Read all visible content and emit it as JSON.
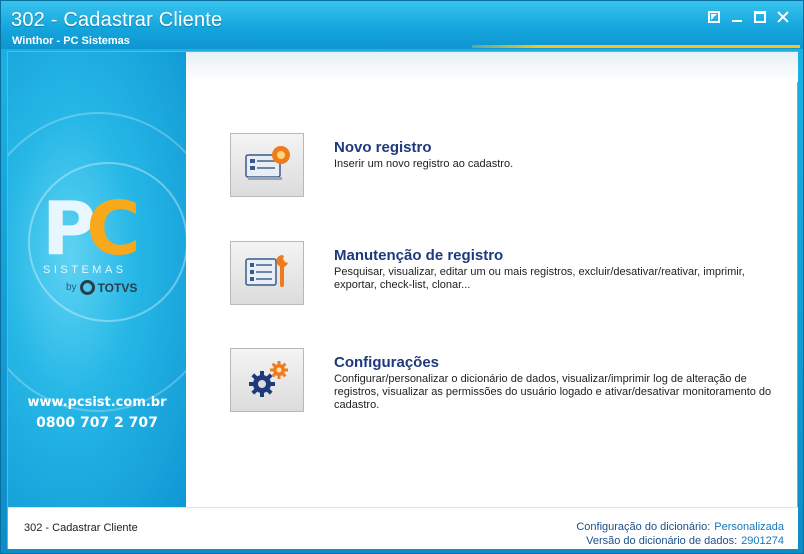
{
  "window": {
    "title": "302 - Cadastrar Cliente",
    "subtitle": "Winthor - PC Sistemas",
    "accent_color": "#f7c31b",
    "title_bar_color": "#14a6dd"
  },
  "sidebar": {
    "logo_p": "P",
    "logo_c": "C",
    "logo_sistemas": "SISTEMAS",
    "logo_by": "by",
    "logo_totvs": "TOTVS",
    "website": "www.pcsist.com.br",
    "phone": "0800 707 2 707"
  },
  "options": [
    {
      "heading": "Novo registro",
      "description": "Inserir um novo registro ao cadastro.",
      "icon": "new-record-icon"
    },
    {
      "heading": "Manutenção de registro",
      "description": "Pesquisar, visualizar, editar um ou mais registros, excluir/desativar/reativar, imprimir, exportar, check-list,  clonar...",
      "icon": "maintenance-icon"
    },
    {
      "heading": "Configurações",
      "description": "Configurar/personalizar o dicionário de dados, visualizar/imprimir log de alteração de registros, visualizar as permissões do usuário logado e ativar/desativar monitoramento do cadastro.",
      "icon": "settings-gears-icon"
    }
  ],
  "footer": {
    "routine": "302 - Cadastrar Cliente",
    "config_label": "Configuração do dicionário:",
    "config_value": "Personalizada",
    "version_label": "Versão do dicionário de dados:",
    "version_value": "2901274"
  }
}
